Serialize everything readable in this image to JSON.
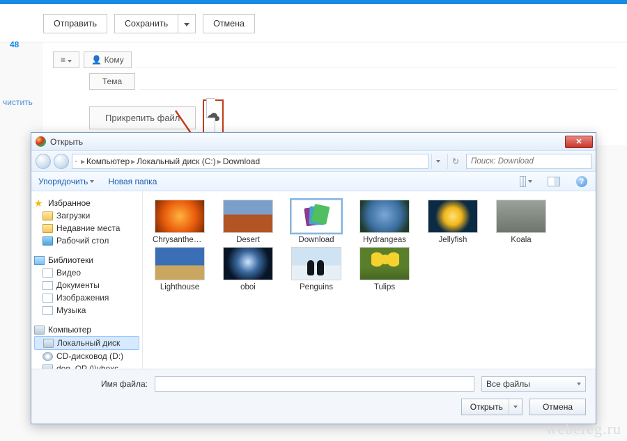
{
  "compose": {
    "send": "Отправить",
    "save": "Сохранить",
    "cancel": "Отмена",
    "menu_icon": "≡",
    "to_label": "Кому",
    "to_icon": "👤",
    "subject_label": "Тема",
    "attach_label": "Прикрепить файл"
  },
  "sidebar": {
    "badge": "48",
    "clear": "чистить"
  },
  "dialog": {
    "title": "Открыть",
    "path_root": "Компьютер",
    "path_drive": "Локальный диск (C:)",
    "path_folder": "Download",
    "refresh_icon": "↻",
    "search_placeholder": "Поиск: Download",
    "cmd_organize": "Упорядочить",
    "cmd_newfolder": "Новая папка",
    "tree": {
      "favorites": "Избранное",
      "downloads": "Загрузки",
      "recent": "Недавние места",
      "desktop": "Рабочий стол",
      "libraries": "Библиотеки",
      "videos": "Видео",
      "documents": "Документы",
      "pictures": "Изображения",
      "music": "Музыка",
      "computer": "Компьютер",
      "local_disk": "Локальный диск",
      "cd": "CD-дисковод (D:)",
      "don": "don_OP (\\\\vboxs"
    },
    "files": [
      {
        "name": "Chrysanthemum",
        "cls": "th-chrys"
      },
      {
        "name": "Desert",
        "cls": "th-desert"
      },
      {
        "name": "Download",
        "cls": "th-dl",
        "selected": true
      },
      {
        "name": "Hydrangeas",
        "cls": "th-hydr"
      },
      {
        "name": "Jellyfish",
        "cls": "th-jelly"
      },
      {
        "name": "Koala",
        "cls": "th-koala"
      },
      {
        "name": "Lighthouse",
        "cls": "th-light"
      },
      {
        "name": "oboi",
        "cls": "th-oboi"
      },
      {
        "name": "Penguins",
        "cls": "th-peng"
      },
      {
        "name": "Tulips",
        "cls": "th-tulip"
      }
    ],
    "filename_label": "Имя файла:",
    "filename_value": "",
    "filter": "Все файлы",
    "open": "Открыть",
    "cancel": "Отмена"
  },
  "watermark": "webereg.ru"
}
